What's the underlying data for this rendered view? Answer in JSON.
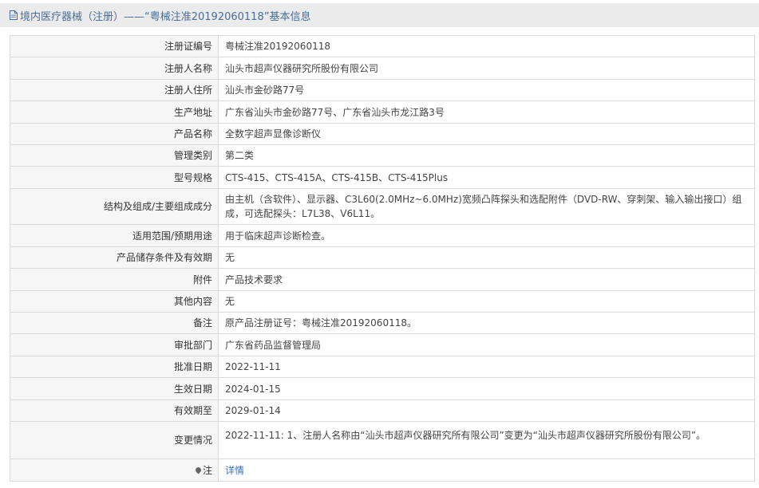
{
  "header": {
    "title": "境内医疗器械（注册）——“粤械注准20192060118”基本信息"
  },
  "rows": [
    {
      "label": "注册证编号",
      "value": "粤械注准20192060118"
    },
    {
      "label": "注册人名称",
      "value": "汕头市超声仪器研究所股份有限公司"
    },
    {
      "label": "注册人住所",
      "value": "汕头市金砂路77号"
    },
    {
      "label": "生产地址",
      "value": "广东省汕头市金砂路77号、广东省汕头市龙江路3号"
    },
    {
      "label": "产品名称",
      "value": "全数字超声显像诊断仪"
    },
    {
      "label": "管理类别",
      "value": "第二类"
    },
    {
      "label": "型号规格",
      "value": "CTS-415、CTS-415A、CTS-415B、CTS-415Plus"
    },
    {
      "label": "结构及组成/主要组成成分",
      "value": "由主机（含软件）、显示器、C3L60(2.0MHz~6.0MHz)宽频凸阵探头和选配附件（DVD-RW、穿刺架、输入输出接口）组成，可选配探头：L7L38、V6L11。"
    },
    {
      "label": "适用范围/预期用途",
      "value": "用于临床超声诊断检查。"
    },
    {
      "label": "产品储存条件及有效期",
      "value": "无"
    },
    {
      "label": "附件",
      "value": "产品技术要求"
    },
    {
      "label": "其他内容",
      "value": "无"
    },
    {
      "label": "备注",
      "value": "原产品注册证号：粤械注准20192060118。"
    },
    {
      "label": "审批部门",
      "value": "广东省药品监督管理局"
    },
    {
      "label": "批准日期",
      "value": "2022-11-11"
    },
    {
      "label": "生效日期",
      "value": "2024-01-15"
    },
    {
      "label": "有效期至",
      "value": "2029-01-14"
    },
    {
      "label": "变更情况",
      "value": "2022-11-11: 1、注册人名称由“汕头市超声仪器研究所有限公司”变更为“汕头市超声仪器研究所股份有限公司”。"
    }
  ],
  "note": {
    "label": "注",
    "link_text": "详情",
    "icon": "pin-icon"
  },
  "colors": {
    "title_text": "#4a6e9a",
    "link": "#3b72b5",
    "border": "#d9d9d9"
  }
}
